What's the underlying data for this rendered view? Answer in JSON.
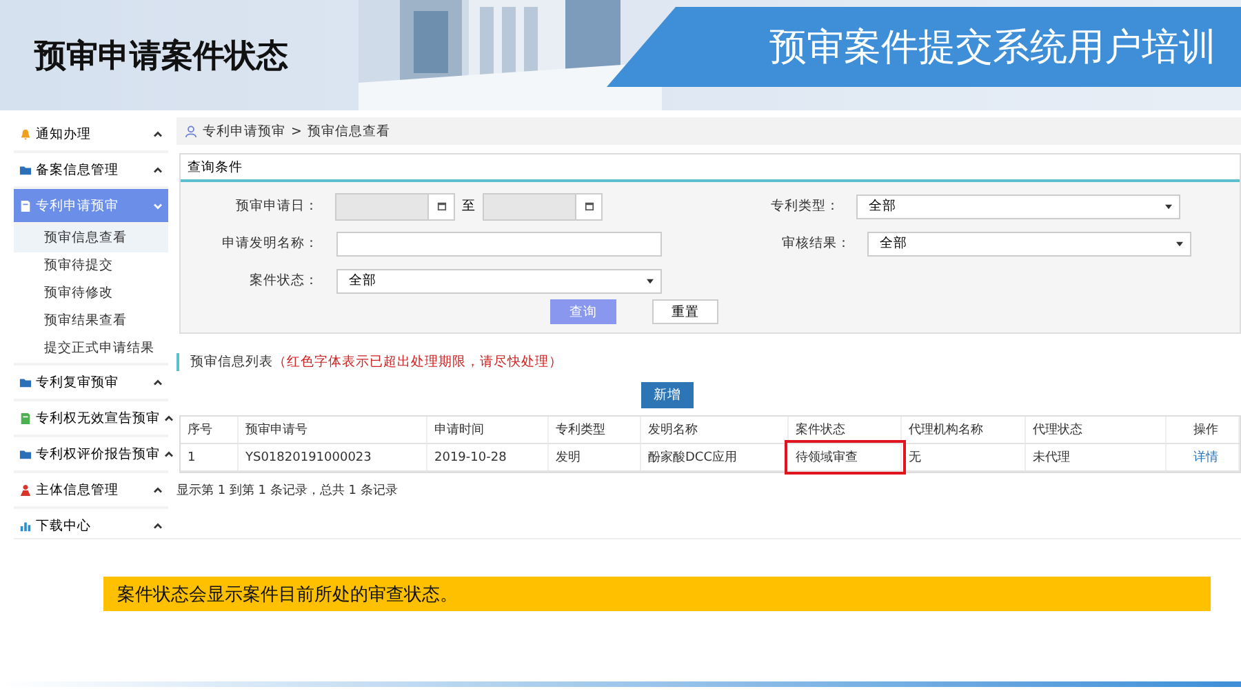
{
  "slide": {
    "title": "预审申请案件状态",
    "banner": "预审案件提交系统用户培训",
    "caption": "案件状态会显示案件目前所处的审查状态。"
  },
  "sidebar": [
    {
      "label": "通知办理",
      "expanded": false
    },
    {
      "label": "备案信息管理",
      "expanded": false
    },
    {
      "label": "专利申请预审",
      "expanded": true,
      "children": [
        {
          "label": "预审信息查看",
          "selected": true
        },
        {
          "label": "预审待提交",
          "selected": false
        },
        {
          "label": "预审待修改",
          "selected": false
        },
        {
          "label": "预审结果查看",
          "selected": false
        },
        {
          "label": "提交正式申请结果",
          "selected": false
        }
      ]
    },
    {
      "label": "专利复审预审",
      "expanded": false
    },
    {
      "label": "专利权无效宣告预审",
      "expanded": false
    },
    {
      "label": "专利权评价报告预审",
      "expanded": false
    },
    {
      "label": "主体信息管理",
      "expanded": false
    },
    {
      "label": "下载中心",
      "expanded": false
    }
  ],
  "breadcrumb": {
    "items": [
      "专利申请预审",
      "预审信息查看"
    ],
    "separator": ">"
  },
  "query": {
    "title": "查询条件",
    "date_label": "预审申请日：",
    "date_to": "至",
    "name_label": "申请发明名称：",
    "status_label": "案件状态：",
    "status_value": "全部",
    "type_label": "专利类型：",
    "type_value": "全部",
    "result_label": "审核结果：",
    "result_value": "全部",
    "search_button": "查询",
    "reset_button": "重置"
  },
  "list": {
    "title": "预审信息列表",
    "note": "（红色字体表示已超出处理期限，请尽快处理）",
    "add_button": "新增",
    "columns": [
      "序号",
      "预审申请号",
      "申请时间",
      "专利类型",
      "发明名称",
      "案件状态",
      "代理机构名称",
      "代理状态",
      "操作"
    ],
    "rows": [
      {
        "cells": [
          {
            "text": "1",
            "kind": "text",
            "highlighted": false
          },
          {
            "text": "YS01820191000023",
            "kind": "text",
            "highlighted": false
          },
          {
            "text": "2019-10-28",
            "kind": "text",
            "highlighted": false
          },
          {
            "text": "发明",
            "kind": "text",
            "highlighted": false
          },
          {
            "text": "酚家酸DCC应用",
            "kind": "text",
            "highlighted": false
          },
          {
            "text": "待领域审查",
            "kind": "text",
            "highlighted": true
          },
          {
            "text": "无",
            "kind": "text",
            "highlighted": false
          },
          {
            "text": "未代理",
            "kind": "text",
            "highlighted": false
          },
          {
            "text": "详情",
            "kind": "link",
            "highlighted": false
          }
        ]
      }
    ],
    "footer": "显示第 1 到第 1 条记录，总共 1 条记录"
  }
}
